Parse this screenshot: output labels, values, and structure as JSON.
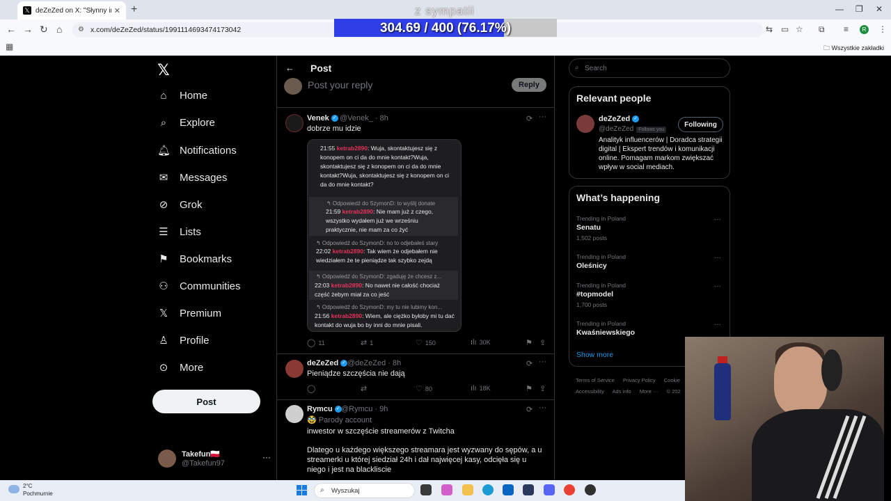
{
  "browser": {
    "tab_title": "deZeZed on X: \"Słynny inwesto",
    "url": "x.com/deZeZed/status/1991114693474173042",
    "all_bookmarks": "Wszystkie zakładki",
    "profile_initial": "R"
  },
  "overlay": {
    "title": "z sympatii",
    "progress_text": "304.69 / 400 (76.17%)",
    "progress_fraction": 0.7617,
    "fill_color": "#2f3ee6"
  },
  "nav": {
    "items": [
      {
        "label": "Home",
        "icon": "home-icon"
      },
      {
        "label": "Explore",
        "icon": "search-icon"
      },
      {
        "label": "Notifications",
        "icon": "bell-icon"
      },
      {
        "label": "Messages",
        "icon": "envelope-icon"
      },
      {
        "label": "Grok",
        "icon": "grok-icon"
      },
      {
        "label": "Lists",
        "icon": "list-icon"
      },
      {
        "label": "Bookmarks",
        "icon": "bookmark-icon"
      },
      {
        "label": "Communities",
        "icon": "people-icon"
      },
      {
        "label": "Premium",
        "icon": "x-icon"
      },
      {
        "label": "Profile",
        "icon": "person-icon"
      },
      {
        "label": "More",
        "icon": "more-circle-icon"
      }
    ],
    "post_button": "Post",
    "me": {
      "name": "Takefun🇵🇱",
      "handle": "@Takefun97",
      "more": "···"
    }
  },
  "main": {
    "title": "Post",
    "reply_placeholder": "Post your reply",
    "reply_button": "Reply",
    "tweets": [
      {
        "name": "Venek",
        "handle": "@Venek_",
        "time": "· 8h",
        "text": "dobrze mu idzie",
        "replies": "11",
        "reposts": "1",
        "likes": "150",
        "views": "30K"
      },
      {
        "name": "deZeZed",
        "handle": "@deZeZed",
        "time": "· 8h",
        "text": "Pieniądze szczęścia nie dają",
        "replies": "",
        "reposts": "",
        "likes": "80",
        "views": "18K"
      },
      {
        "name": "Rymcu",
        "handle": "@Rymcu",
        "time": "· 9h",
        "badge": "🥸 Parody account",
        "text1": "inwestor w szczęście streamerów z Twitcha",
        "text2": "Dlatego u każdego większego streamara jest wyzwany do sępów, a u streamerki u której siedział 24h i dał najwięcej kasy, odcięła się u niego i jest na blackliscie"
      }
    ],
    "chat": {
      "m1_time": "21:55",
      "m1_nick": "ketrab2890",
      "m1_text": ": Wuja, skontaktujesz się z konopem on ci da do mnie kontakt?Wuja, skontaktujesz się z konopem on ci da do mnie kontakt?Wuja, skontaktujesz się z konopem on ci da do mnie kontakt?",
      "r2": "↰ Odpowiedź do SzymonD: to wyślij donate",
      "m2_time": "21:59",
      "m2_nick": "ketrab2890",
      "m2_text": ": Nie mam już z czego, wszystko wydałem już we wrześniu praktycznie, nie mam za co żyć",
      "r3": "↰ Odpowiedź do SzymonD: no to odjebałeś stary",
      "m3_time": "22:02",
      "m3_nick": "ketrab2890",
      "m3_text": ": Tak wiem że odjebałem nie wiedziałem że te pieniądze tak szybko zejdą",
      "r4": "↰ Odpowiedź do SzymonD: zgaduję że chcesz z...",
      "m4_time": "22:03",
      "m4_nick": "ketrab2890",
      "m4_text": ": No nawet nie całość chociaż część żebym miał za co jeść",
      "r5": "↰ Odpowiedź do SzymonD: my tu nie lubimy kon...",
      "m5_time": "21:56",
      "m5_nick": "ketrab2890",
      "m5_text": ": Wiem, ale ciężko byłoby mi tu dać kontakt do wuja bo by inni do mnie pisali."
    }
  },
  "right": {
    "search_placeholder": "Search",
    "relevant_title": "Relevant people",
    "person": {
      "name": "deZeZed",
      "handle": "@deZeZed",
      "follows_you": "Follows you",
      "button": "Following",
      "bio": "Analityk influencerów | Doradca strategii digital | Ekspert trendów i komunikacji online. Pomagam markom zwiększać wpływ w social mediach."
    },
    "happening_title": "What’s happening",
    "trends": [
      {
        "context": "Trending in Poland",
        "name": "Senatu",
        "posts": "1,502 posts"
      },
      {
        "context": "Trending in Poland",
        "name": "Oleśnicy",
        "posts": ""
      },
      {
        "context": "Trending in Poland",
        "name": "#topmodel",
        "posts": "1,700 posts"
      },
      {
        "context": "Trending in Poland",
        "name": "Kwaśniewskiego",
        "posts": ""
      }
    ],
    "show_more": "Show more",
    "footer1": [
      "Terms of Service",
      "Privacy Policy",
      "Cookie"
    ],
    "footer2": [
      "Accessibility",
      "Ads info",
      "More ···",
      "© 202"
    ]
  },
  "taskbar": {
    "temp": "2°C",
    "weather": "Pochmurnie",
    "search": "Wyszukaj"
  }
}
